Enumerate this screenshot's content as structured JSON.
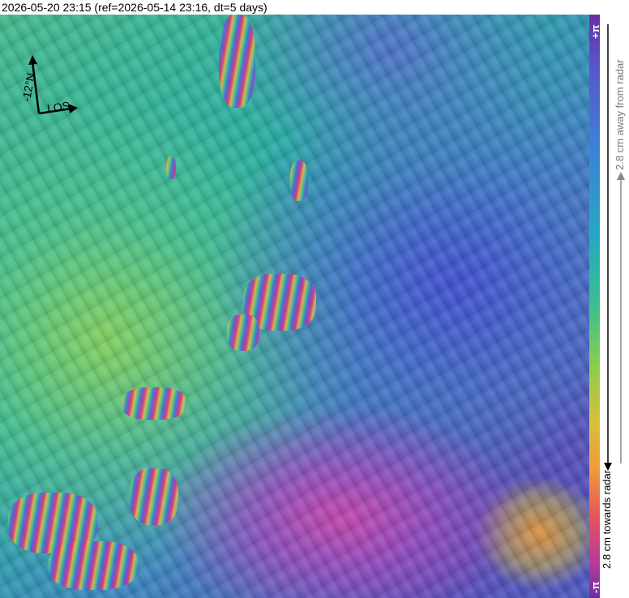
{
  "title": "2026-05-20 23:15 (ref=2026-05-14 23:16, dt=5 days)",
  "map": {
    "north_label": "-12°N",
    "los_label": "LOS"
  },
  "colorbar": {
    "top_symbol": "+π",
    "bottom_symbol": "-π",
    "away_label": "2.8 cm away from radar",
    "towards_label": "2.8 cm towards radar",
    "colors": [
      "#6a2ea0",
      "#5a52c9",
      "#3f7fd8",
      "#24a8c2",
      "#3cc08e",
      "#8acc4e",
      "#d7c23a",
      "#f09a3a",
      "#e5555b",
      "#b83a9a"
    ]
  }
}
